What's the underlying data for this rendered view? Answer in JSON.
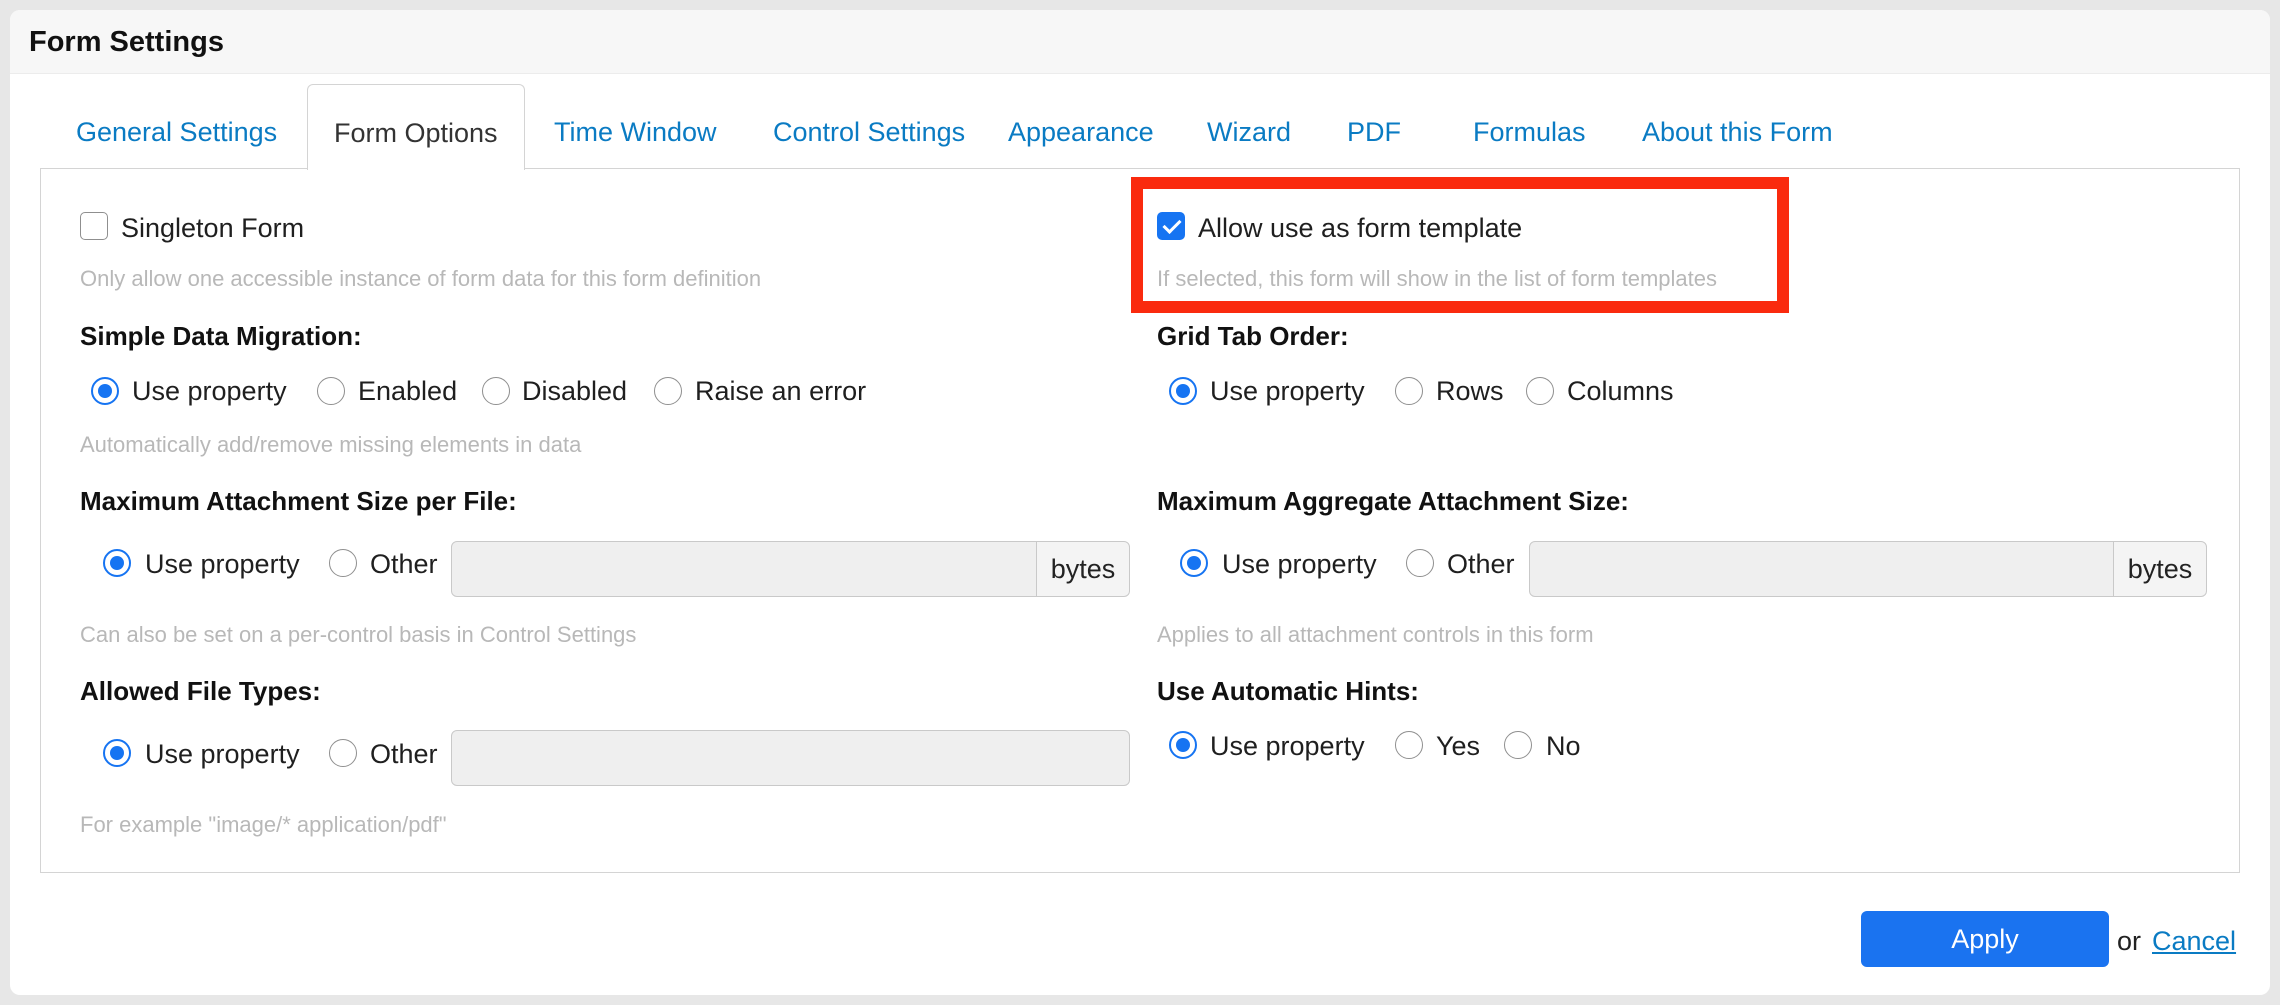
{
  "dialog": {
    "title": "Form Settings"
  },
  "tabs": [
    {
      "label": "General Settings"
    },
    {
      "label": "Form Options",
      "active": true
    },
    {
      "label": "Time Window"
    },
    {
      "label": "Control Settings"
    },
    {
      "label": "Appearance"
    },
    {
      "label": "Wizard"
    },
    {
      "label": "PDF"
    },
    {
      "label": "Formulas"
    },
    {
      "label": "About this Form"
    }
  ],
  "left": {
    "singleton": {
      "label": "Singleton Form",
      "checked": false,
      "hint": "Only allow one accessible instance of form data for this form definition"
    },
    "migration": {
      "heading": "Simple Data Migration:",
      "options": [
        "Use property",
        "Enabled",
        "Disabled",
        "Raise an error"
      ],
      "selected": "Use property",
      "hint": "Automatically add/remove missing elements in data"
    },
    "max_attachment": {
      "heading": "Maximum Attachment Size per File:",
      "options": [
        "Use property",
        "Other"
      ],
      "selected": "Use property",
      "value": "",
      "unit": "bytes",
      "hint": "Can also be set on a per-control basis in Control Settings"
    },
    "file_types": {
      "heading": "Allowed File Types:",
      "options": [
        "Use property",
        "Other"
      ],
      "selected": "Use property",
      "value": "",
      "hint": "For example \"image/* application/pdf\""
    }
  },
  "right": {
    "template": {
      "label": "Allow use as form template",
      "checked": true,
      "hint": "If selected, this form will show in the list of form templates"
    },
    "grid_tab_order": {
      "heading": "Grid Tab Order:",
      "options": [
        "Use property",
        "Rows",
        "Columns"
      ],
      "selected": "Use property"
    },
    "max_aggregate": {
      "heading": "Maximum Aggregate Attachment Size:",
      "options": [
        "Use property",
        "Other"
      ],
      "selected": "Use property",
      "value": "",
      "unit": "bytes",
      "hint": "Applies to all attachment controls in this form"
    },
    "auto_hints": {
      "heading": "Use Automatic Hints:",
      "options": [
        "Use property",
        "Yes",
        "No"
      ],
      "selected": "Use property"
    }
  },
  "footer": {
    "apply_label": "Apply",
    "or_text": "or",
    "cancel_label": "Cancel"
  },
  "colors": {
    "accent": "#1a73f0",
    "link": "#0a7bc3",
    "highlight": "#fa2a0e"
  }
}
